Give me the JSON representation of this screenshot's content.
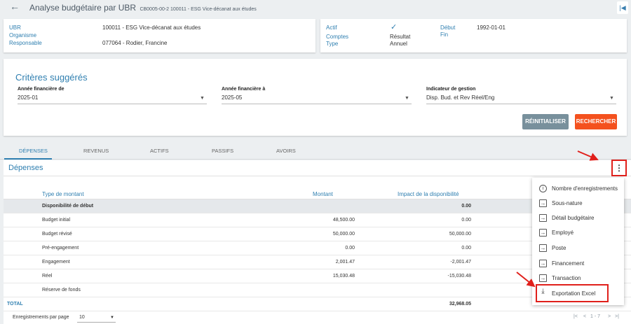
{
  "header": {
    "back_icon": "arrow-left-icon",
    "title": "Analyse budgétaire par UBR",
    "code": "CB0005-00-2 100011 - ESG Vice-décanat aux études",
    "collapse_icon": "collapse-right-icon"
  },
  "info_left": {
    "labels": [
      "UBR",
      "Organisme",
      "Responsable"
    ],
    "values": [
      "100011 - ESG Vice-décanat aux études",
      "077064 - Rodier, Francine"
    ]
  },
  "info_right": {
    "actif_label": "Actif",
    "comptes_label": "Comptes",
    "type_label": "Type",
    "actif_icon": "checkmark-icon",
    "comptes_value": "Résultat",
    "type_value": "Annuel",
    "debut_label": "Début",
    "fin_label": "Fin",
    "debut_value": "1992-01-01"
  },
  "criteria": {
    "title": "Critères suggérés",
    "fields": [
      {
        "label": "Année financière de",
        "value": "2025-01"
      },
      {
        "label": "Année financière à",
        "value": "2025-05"
      },
      {
        "label": "Indicateur de gestion",
        "value": "Disp. Bud. et Rev Réel/Eng"
      }
    ],
    "reset_label": "RÉINITIALISER",
    "search_label": "RECHERCHER",
    "colors": {
      "reset": "#78909c",
      "search": "#f4511e"
    }
  },
  "tabs": [
    "DÉPENSES",
    "REVENUS",
    "ACTIFS",
    "PASSIFS",
    "AVOIRS"
  ],
  "expenses": {
    "title": "Dépenses",
    "columns": [
      "Type de montant",
      "Montant",
      "Impact de la disponibilité"
    ],
    "rows": [
      {
        "type": "Disponibilité de début",
        "montant": "",
        "impact": "0.00"
      },
      {
        "type": "Budget initial",
        "montant": "48,500.00",
        "impact": "0.00"
      },
      {
        "type": "Budget révisé",
        "montant": "50,000.00",
        "impact": "50,000.00"
      },
      {
        "type": "Pré-engagement",
        "montant": "0.00",
        "impact": "0.00"
      },
      {
        "type": "Engagement",
        "montant": "2,001.47",
        "impact": "-2,001.47"
      },
      {
        "type": "Réel",
        "montant": "15,030.48",
        "impact": "-15,030.48"
      },
      {
        "type": "Réserve de fonds",
        "montant": "",
        "impact": ""
      }
    ],
    "total_label": "TOTAL",
    "total_value": "32,968.05"
  },
  "menu": {
    "items": [
      {
        "label": "Nombre d'enregistrements",
        "icon": "info-icon"
      },
      {
        "label": "Sous-nature",
        "icon": "arrow-right-box-icon"
      },
      {
        "label": "Détail budgétaire",
        "icon": "arrow-right-box-icon"
      },
      {
        "label": "Employé",
        "icon": "arrow-right-box-icon"
      },
      {
        "label": "Poste",
        "icon": "arrow-right-box-icon"
      },
      {
        "label": "Financement",
        "icon": "arrow-right-box-icon"
      },
      {
        "label": "Transaction",
        "icon": "arrow-right-box-icon"
      },
      {
        "label": "Exportation Excel",
        "icon": "download-icon"
      }
    ]
  },
  "footer": {
    "per_page_label": "Enregistrements par page",
    "per_page_value": "10",
    "range": "1 - 7"
  },
  "annotation_color": "#e0201b"
}
